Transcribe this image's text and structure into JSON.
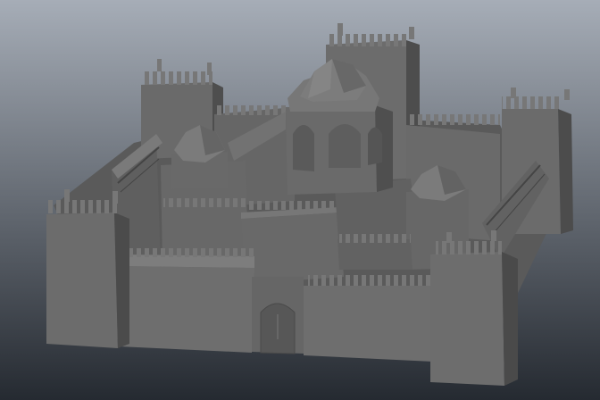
{
  "scene": {
    "subject": "castle-3d-model",
    "background_top": "#a6adb7",
    "background_bottom": "#252a31",
    "model_color": "#6d6d6d"
  }
}
